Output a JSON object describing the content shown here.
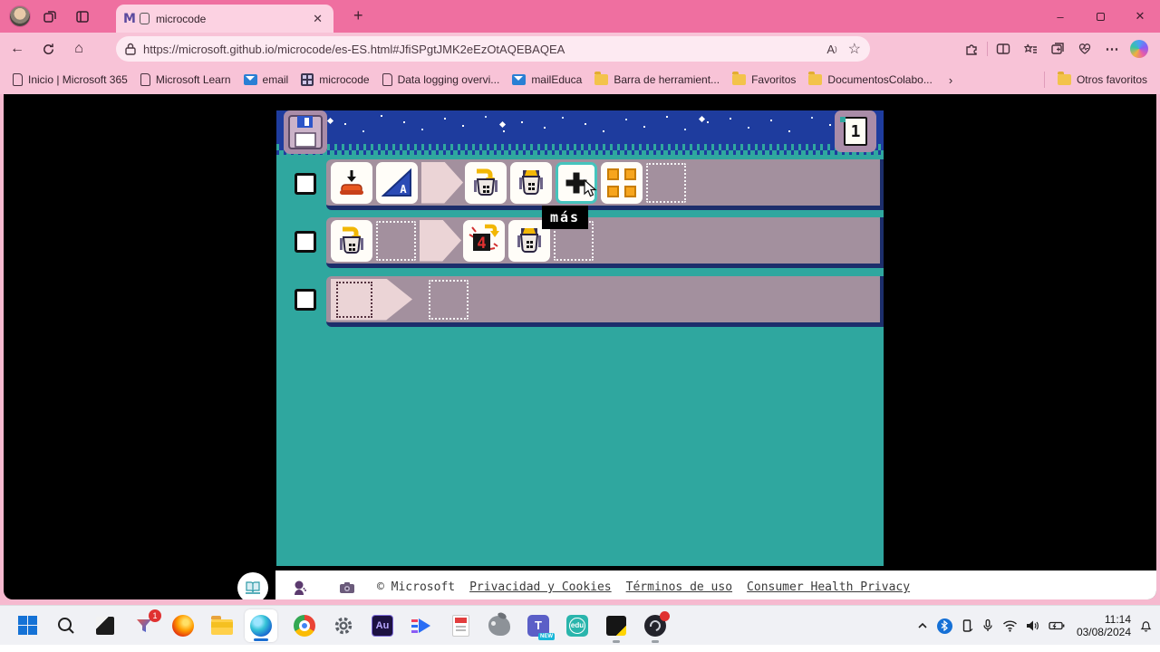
{
  "colors": {
    "chrome_pink": "#ef6fa0",
    "chrome_light_pink": "#f8c3d7",
    "page_black": "#000000",
    "app_teal": "#2fa79f",
    "banner_blue": "#1e3c9e",
    "rule_mauve": "#a3909e",
    "rule_border_navy": "#1c2e6b",
    "tile_highlight_teal": "#45c4bd",
    "tooltip_bg": "#000000",
    "tooltip_text": "#ffffff"
  },
  "browser": {
    "tab_title": "microcode",
    "tab_favicon": "M",
    "url": "https://microsoft.github.io/microcode/es-ES.html#JfiSPgtJMK2eEzOtAQEBAQEA",
    "bookmarks": [
      {
        "label": "Inicio | Microsoft 365",
        "icon": "page"
      },
      {
        "label": "Microsoft Learn",
        "icon": "page"
      },
      {
        "label": "email",
        "icon": "mail"
      },
      {
        "label": "microcode",
        "icon": "microcode"
      },
      {
        "label": "Data logging overvi...",
        "icon": "page"
      },
      {
        "label": "mailEduca",
        "icon": "mail"
      },
      {
        "label": "Barra de herramient...",
        "icon": "folder"
      },
      {
        "label": "Favoritos",
        "icon": "folder"
      },
      {
        "label": "DocumentosColabo...",
        "icon": "folder"
      }
    ],
    "other_favorites_label": "Otros favoritos",
    "more_glyph": "›",
    "new_tab_glyph": "+",
    "close_glyph": "✕",
    "minimize_glyph": "–",
    "back_glyph": "←",
    "home_glyph": "⌂",
    "read_aloud_glyph": "A",
    "star_glyph": "☆",
    "more_dots_glyph": "⋯"
  },
  "editor": {
    "page_number": "1",
    "tooltip_label": "más",
    "button_a_label": "A",
    "value_tile_label": "4",
    "rules": [
      {
        "when": [
          "press-button",
          "button-a"
        ],
        "do": [
          "pour-into-cup-x",
          "cup-x",
          "add-tile-selected",
          "led-grid",
          "empty-slot"
        ]
      },
      {
        "when": [
          "pour-into-cup-x",
          "empty-slot"
        ],
        "do": [
          "value-4",
          "cup-x",
          "empty-slot"
        ]
      },
      {
        "when": [
          "empty-when"
        ],
        "do": [
          "empty-slot"
        ]
      }
    ]
  },
  "footer": {
    "copyright": "© Microsoft",
    "links": [
      "Privacidad y Cookies",
      "Términos de uso",
      "Consumer Health Privacy"
    ]
  },
  "taskbar": {
    "badge_count": "1",
    "teams_badge": "NEW",
    "edu_label": "edu",
    "audition_label": "Au",
    "clock_time": "11:14",
    "clock_date": "03/08/2024"
  }
}
